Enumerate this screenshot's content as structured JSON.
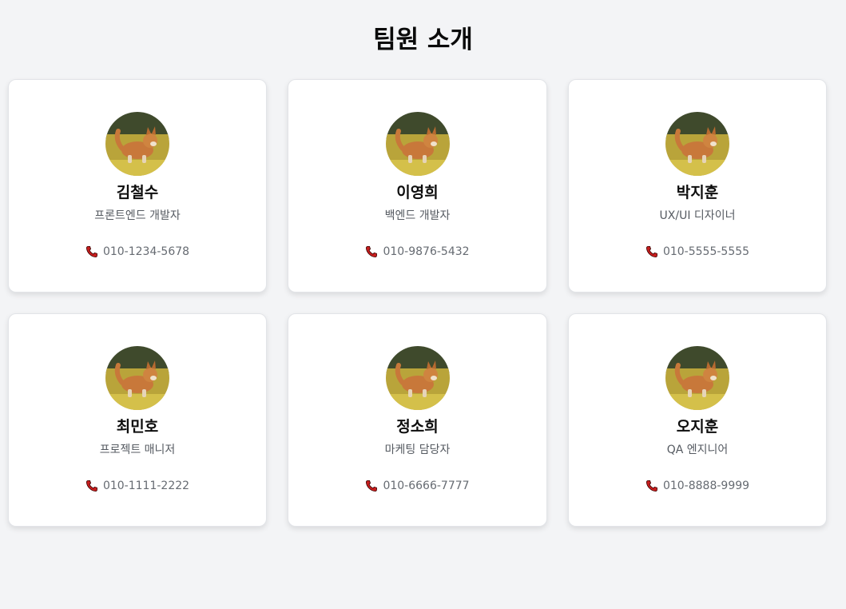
{
  "page": {
    "title": "팀원 소개"
  },
  "members": [
    {
      "name": "김철수",
      "role": "프론트엔드 개발자",
      "phone": "010-1234-5678"
    },
    {
      "name": "이영희",
      "role": "백엔드 개발자",
      "phone": "010-9876-5432"
    },
    {
      "name": "박지훈",
      "role": "UX/UI 디자이너",
      "phone": "010-5555-5555"
    },
    {
      "name": "최민호",
      "role": "프로젝트 매니저",
      "phone": "010-1111-2222"
    },
    {
      "name": "정소희",
      "role": "마케팅 담당자",
      "phone": "010-6666-7777"
    },
    {
      "name": "오지훈",
      "role": "QA 엔지니어",
      "phone": "010-8888-9999"
    }
  ],
  "icons": {
    "avatar": "dog-photo-avatar",
    "phone": "phone-icon"
  },
  "colors": {
    "background": "#f3f4f6",
    "card": "#ffffff",
    "phone_icon": "#c81e1e"
  }
}
